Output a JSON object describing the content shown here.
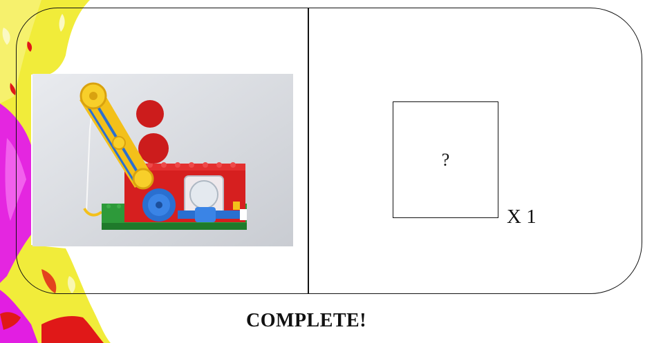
{
  "task_card": {
    "image_subject": "red-lego-gear-machine",
    "placeholder": "?",
    "quantity": "X 1"
  },
  "status_text": "COMPLETE!",
  "colors": {
    "decor_yellow": "#f2ec2a",
    "decor_magenta": "#e21ee2",
    "decor_red": "#e01818",
    "brick_red": "#d61f1f",
    "brick_yellow": "#f3c01a",
    "gear_blue": "#2a6fd0",
    "base_green": "#2d9a3a"
  }
}
